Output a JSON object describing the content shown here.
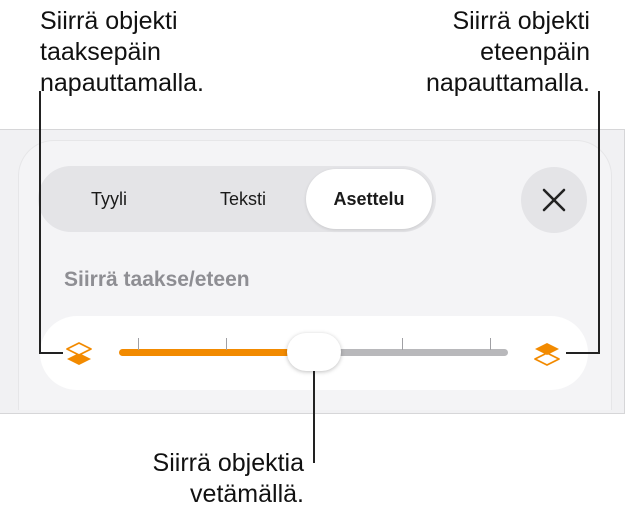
{
  "callouts": {
    "left": "Siirrä objekti\ntaaksepäin\nnapauttamalla.",
    "right": "Siirrä objekti\neteenpäin\nnapauttamalla.",
    "bottom": "Siirrä objektia\nvetämällä."
  },
  "tabs": [
    {
      "label": "Tyyli",
      "selected": false
    },
    {
      "label": "Teksti",
      "selected": false
    },
    {
      "label": "Asettelu",
      "selected": true
    }
  ],
  "close_icon": "close-icon",
  "section": {
    "title": "Siirrä taakse/eteen"
  },
  "slider": {
    "value_fraction": 0.5,
    "tick_count": 5,
    "back_icon": "layers-back-icon",
    "front_icon": "layers-front-icon"
  },
  "colors": {
    "accent": "#f28a00",
    "track_inactive": "#b8b8bb",
    "panel": "#f4f4f6"
  }
}
